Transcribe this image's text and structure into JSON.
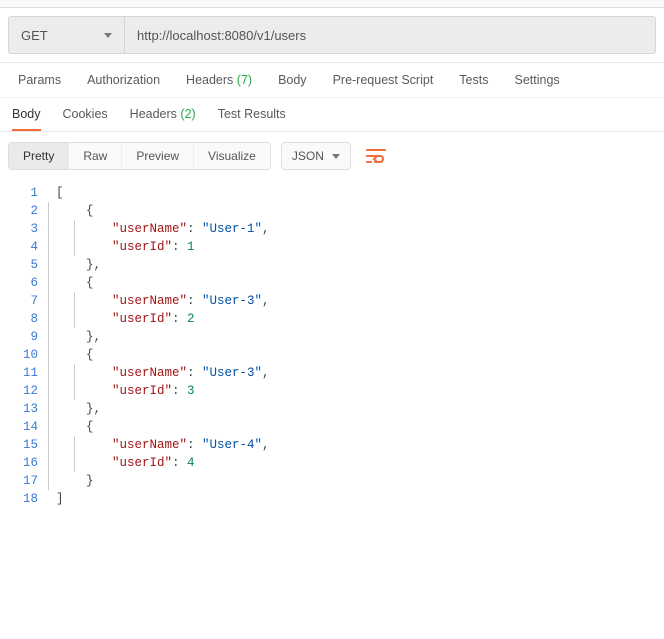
{
  "request": {
    "method": "GET",
    "url": "http://localhost:8080/v1/users"
  },
  "request_tabs": {
    "params": "Params",
    "authorization": "Authorization",
    "headers_label": "Headers",
    "headers_count": "(7)",
    "body": "Body",
    "pre_request": "Pre-request Script",
    "tests": "Tests",
    "settings": "Settings"
  },
  "response_tabs": {
    "body": "Body",
    "cookies": "Cookies",
    "headers_label": "Headers",
    "headers_count": "(2)",
    "test_results": "Test Results"
  },
  "view_modes": {
    "pretty": "Pretty",
    "raw": "Raw",
    "preview": "Preview",
    "visualize": "Visualize"
  },
  "format_select": "JSON",
  "response_body": {
    "lines": [
      {
        "n": "1",
        "indent": 0,
        "bar1": false,
        "bar2": false,
        "tokens": [
          {
            "t": "punct",
            "v": "["
          }
        ]
      },
      {
        "n": "2",
        "indent": 1,
        "bar1": true,
        "bar2": false,
        "tokens": [
          {
            "t": "punct",
            "v": "{"
          }
        ]
      },
      {
        "n": "3",
        "indent": 2,
        "bar1": true,
        "bar2": true,
        "tokens": [
          {
            "t": "key",
            "v": "\"userName\""
          },
          {
            "t": "punct",
            "v": ": "
          },
          {
            "t": "str",
            "v": "\"User-1\""
          },
          {
            "t": "punct",
            "v": ","
          }
        ]
      },
      {
        "n": "4",
        "indent": 2,
        "bar1": true,
        "bar2": true,
        "tokens": [
          {
            "t": "key",
            "v": "\"userId\""
          },
          {
            "t": "punct",
            "v": ": "
          },
          {
            "t": "num",
            "v": "1"
          }
        ]
      },
      {
        "n": "5",
        "indent": 1,
        "bar1": true,
        "bar2": false,
        "tokens": [
          {
            "t": "punct",
            "v": "},"
          }
        ]
      },
      {
        "n": "6",
        "indent": 1,
        "bar1": true,
        "bar2": false,
        "tokens": [
          {
            "t": "punct",
            "v": "{"
          }
        ]
      },
      {
        "n": "7",
        "indent": 2,
        "bar1": true,
        "bar2": true,
        "tokens": [
          {
            "t": "key",
            "v": "\"userName\""
          },
          {
            "t": "punct",
            "v": ": "
          },
          {
            "t": "str",
            "v": "\"User-3\""
          },
          {
            "t": "punct",
            "v": ","
          }
        ]
      },
      {
        "n": "8",
        "indent": 2,
        "bar1": true,
        "bar2": true,
        "tokens": [
          {
            "t": "key",
            "v": "\"userId\""
          },
          {
            "t": "punct",
            "v": ": "
          },
          {
            "t": "num",
            "v": "2"
          }
        ]
      },
      {
        "n": "9",
        "indent": 1,
        "bar1": true,
        "bar2": false,
        "tokens": [
          {
            "t": "punct",
            "v": "},"
          }
        ]
      },
      {
        "n": "10",
        "indent": 1,
        "bar1": true,
        "bar2": false,
        "tokens": [
          {
            "t": "punct",
            "v": "{"
          }
        ]
      },
      {
        "n": "11",
        "indent": 2,
        "bar1": true,
        "bar2": true,
        "tokens": [
          {
            "t": "key",
            "v": "\"userName\""
          },
          {
            "t": "punct",
            "v": ": "
          },
          {
            "t": "str",
            "v": "\"User-3\""
          },
          {
            "t": "punct",
            "v": ","
          }
        ]
      },
      {
        "n": "12",
        "indent": 2,
        "bar1": true,
        "bar2": true,
        "tokens": [
          {
            "t": "key",
            "v": "\"userId\""
          },
          {
            "t": "punct",
            "v": ": "
          },
          {
            "t": "num",
            "v": "3"
          }
        ]
      },
      {
        "n": "13",
        "indent": 1,
        "bar1": true,
        "bar2": false,
        "tokens": [
          {
            "t": "punct",
            "v": "},"
          }
        ]
      },
      {
        "n": "14",
        "indent": 1,
        "bar1": true,
        "bar2": false,
        "tokens": [
          {
            "t": "punct",
            "v": "{"
          }
        ]
      },
      {
        "n": "15",
        "indent": 2,
        "bar1": true,
        "bar2": true,
        "tokens": [
          {
            "t": "key",
            "v": "\"userName\""
          },
          {
            "t": "punct",
            "v": ": "
          },
          {
            "t": "str",
            "v": "\"User-4\""
          },
          {
            "t": "punct",
            "v": ","
          }
        ]
      },
      {
        "n": "16",
        "indent": 2,
        "bar1": true,
        "bar2": true,
        "tokens": [
          {
            "t": "key",
            "v": "\"userId\""
          },
          {
            "t": "punct",
            "v": ": "
          },
          {
            "t": "num",
            "v": "4"
          }
        ]
      },
      {
        "n": "17",
        "indent": 1,
        "bar1": true,
        "bar2": false,
        "tokens": [
          {
            "t": "punct",
            "v": "}"
          }
        ]
      },
      {
        "n": "18",
        "indent": 0,
        "bar1": false,
        "bar2": false,
        "tokens": [
          {
            "t": "punct",
            "v": "]"
          }
        ]
      }
    ]
  }
}
